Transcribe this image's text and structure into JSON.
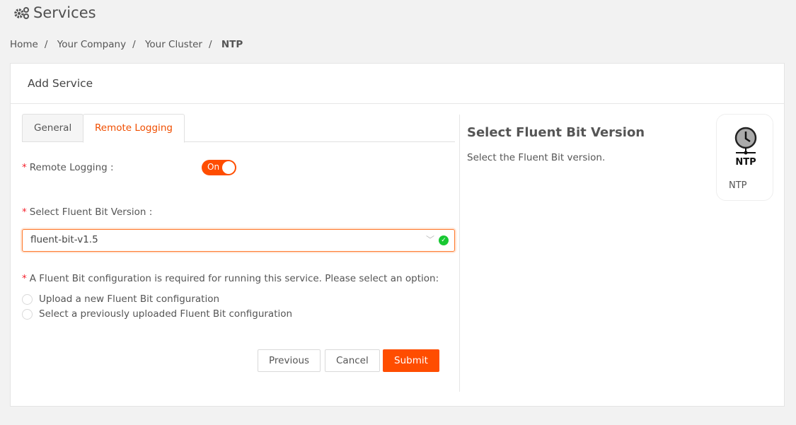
{
  "header": {
    "title": "Services",
    "icon": "gears-icon"
  },
  "breadcrumb": [
    "Home",
    "Your Company",
    "Your Cluster",
    "NTP"
  ],
  "card": {
    "title": "Add Service"
  },
  "tabs": [
    {
      "label": "General",
      "active": false
    },
    {
      "label": "Remote Logging",
      "active": true
    }
  ],
  "form": {
    "remote_logging_label": "Remote Logging",
    "remote_logging_toggle": "On",
    "version_label": "Select Fluent Bit Version",
    "version_value": "fluent-bit-v1.5",
    "config_label": "A Fluent Bit configuration is required for running this service. Please select an option:",
    "options": [
      "Upload a new Fluent Bit configuration",
      "Select a previously uploaded Fluent Bit configuration"
    ]
  },
  "buttons": {
    "previous": "Previous",
    "cancel": "Cancel",
    "submit": "Submit"
  },
  "help": {
    "title": "Select Fluent Bit Version",
    "description": "Select the Fluent Bit version."
  },
  "service": {
    "name": "NTP",
    "logo_text": "NTP"
  },
  "colors": {
    "accent": "#ff4d00",
    "success": "#18c832"
  }
}
